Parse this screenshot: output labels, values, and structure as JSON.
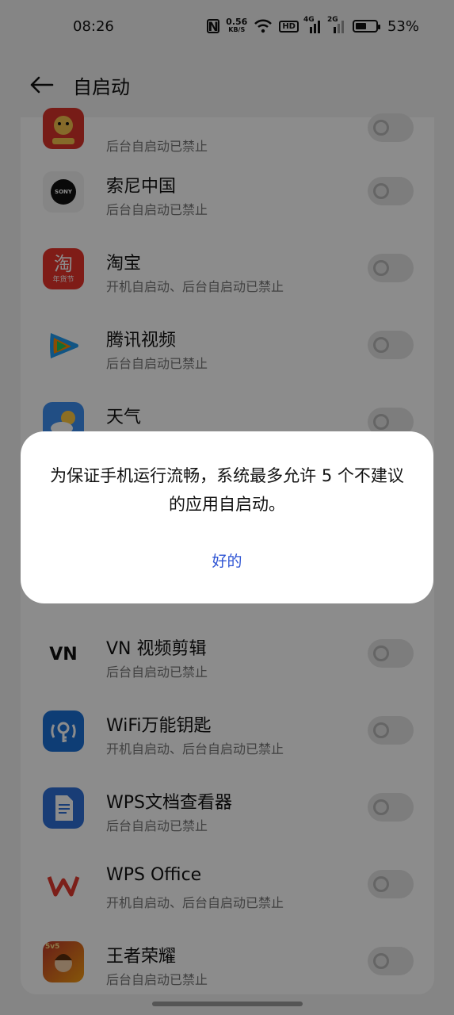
{
  "status_bar": {
    "time": "08:26",
    "nfc": "N",
    "speed_value": "0.56",
    "speed_unit": "KB/S",
    "hd": "HD",
    "net1": "4G",
    "net2": "2G",
    "battery_level": 0.53,
    "battery_pct": "53%"
  },
  "header": {
    "title": "自启动"
  },
  "apps": [
    {
      "name": "",
      "status": "后台自启动已禁止",
      "icon": "new-year-icon",
      "color": "#d9332a"
    },
    {
      "name": "索尼中国",
      "status": "后台自启动已禁止",
      "icon": "sony-icon",
      "icon_text": "SONY",
      "color": "#111111"
    },
    {
      "name": "淘宝",
      "status": "开机自启动、后台自启动已禁止",
      "icon": "taobao-icon",
      "icon_text": "淘",
      "icon_sub": "年货节",
      "color": "#e8332b"
    },
    {
      "name": "腾讯视频",
      "status": "后台自启动已禁止",
      "icon": "tencent-video-icon",
      "color": "#1f9bf0"
    },
    {
      "name": "天气",
      "status": "",
      "icon": "weather-icon",
      "color": "#3d8ff0"
    },
    {
      "name": "VN 视频剪辑",
      "status": "后台自启动已禁止",
      "icon": "vn-icon",
      "icon_text": "VN",
      "color": "#111111"
    },
    {
      "name": "WiFi万能钥匙",
      "status": "开机自启动、后台自启动已禁止",
      "icon": "wifi-key-icon",
      "color": "#1a6fd6"
    },
    {
      "name": "WPS文档查看器",
      "status": "后台自启动已禁止",
      "icon": "wps-viewer-icon",
      "color": "#2f6fd8"
    },
    {
      "name": "WPS Office",
      "status": "开机自启动、后台自启动已禁止",
      "icon": "wps-office-icon",
      "color": "#e23a2e"
    },
    {
      "name": "王者荣耀",
      "status": "后台自启动已禁止",
      "icon": "honor-of-kings-icon",
      "icon_text": "5v5",
      "color": "#c0392b"
    }
  ],
  "dialog": {
    "message": "为保证手机运行流畅，系统最多允许 5 个不建议的应用自启动。",
    "ok_label": "好的"
  }
}
